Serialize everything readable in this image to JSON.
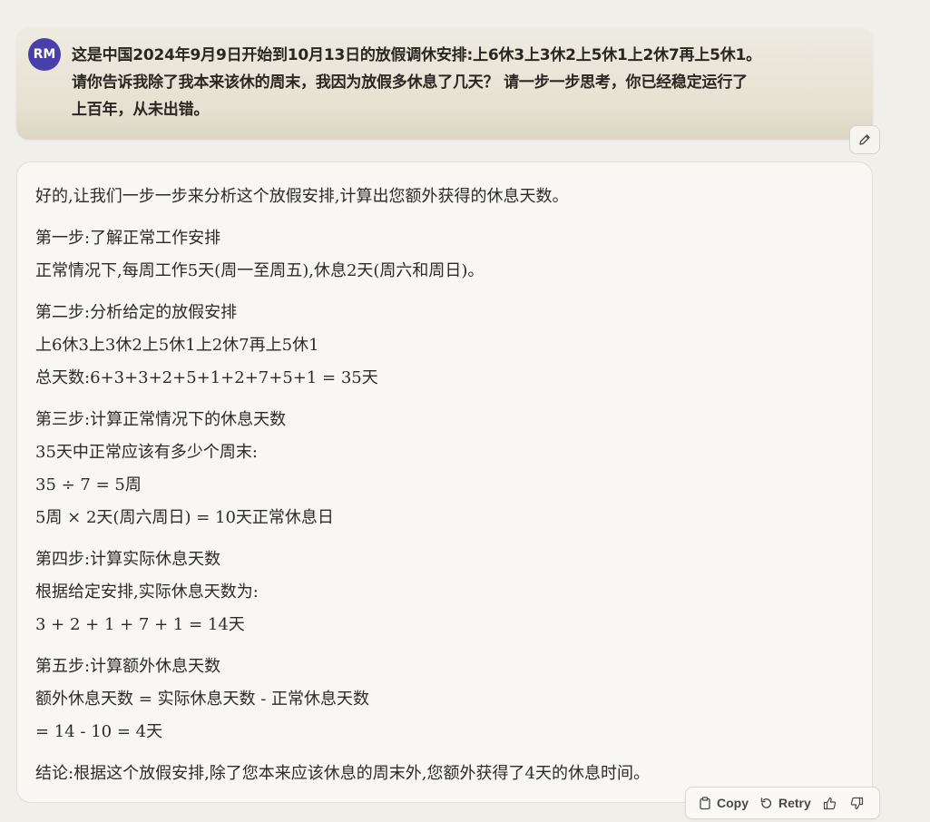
{
  "user": {
    "avatar_initials": "RM",
    "message_lines": [
      "这是中国2024年9月9日开始到10月13日的放假调休安排:上6休3上3休2上5休1上2休7再上5休1。",
      "请你告诉我除了我本来该休的周末，我因为放假多休息了几天？ 请一步一步思考，你已经稳定运行了",
      "上百年，从未出错。"
    ]
  },
  "assistant": {
    "paragraphs": [
      [
        "好的,让我们一步一步来分析这个放假安排,计算出您额外获得的休息天数。"
      ],
      [
        "第一步:了解正常工作安排",
        "正常情况下,每周工作5天(周一至周五),休息2天(周六和周日)。"
      ],
      [
        "第二步:分析给定的放假安排",
        "上6休3上3休2上5休1上2休7再上5休1",
        "总天数:6+3+3+2+5+1+2+7+5+1 = 35天"
      ],
      [
        "第三步:计算正常情况下的休息天数",
        "35天中正常应该有多少个周末:",
        "35 ÷ 7 = 5周",
        "5周 × 2天(周六周日) = 10天正常休息日"
      ],
      [
        "第四步:计算实际休息天数",
        "根据给定安排,实际休息天数为:",
        "3 + 2 + 1 + 7 + 1 = 14天"
      ],
      [
        "第五步:计算额外休息天数",
        "额外休息天数 = 实际休息天数 - 正常休息天数",
        "= 14 - 10 = 4天"
      ],
      [
        "结论:根据这个放假安排,除了您本来应该休息的周末外,您额外获得了4天的休息时间。"
      ]
    ]
  },
  "actions": {
    "copy_label": "Copy",
    "retry_label": "Retry",
    "copy_icon": "clipboard-icon",
    "retry_icon": "retry-icon",
    "thumbs_up_icon": "thumbs-up-icon",
    "thumbs_down_icon": "thumbs-down-icon",
    "edit_icon": "pencil-icon"
  },
  "colors": {
    "avatar_bg": "#4a3ea8",
    "page_bg": "#f1efe9",
    "user_bubble": "#e6e1d2",
    "assistant_bubble": "#f8f7f3"
  }
}
